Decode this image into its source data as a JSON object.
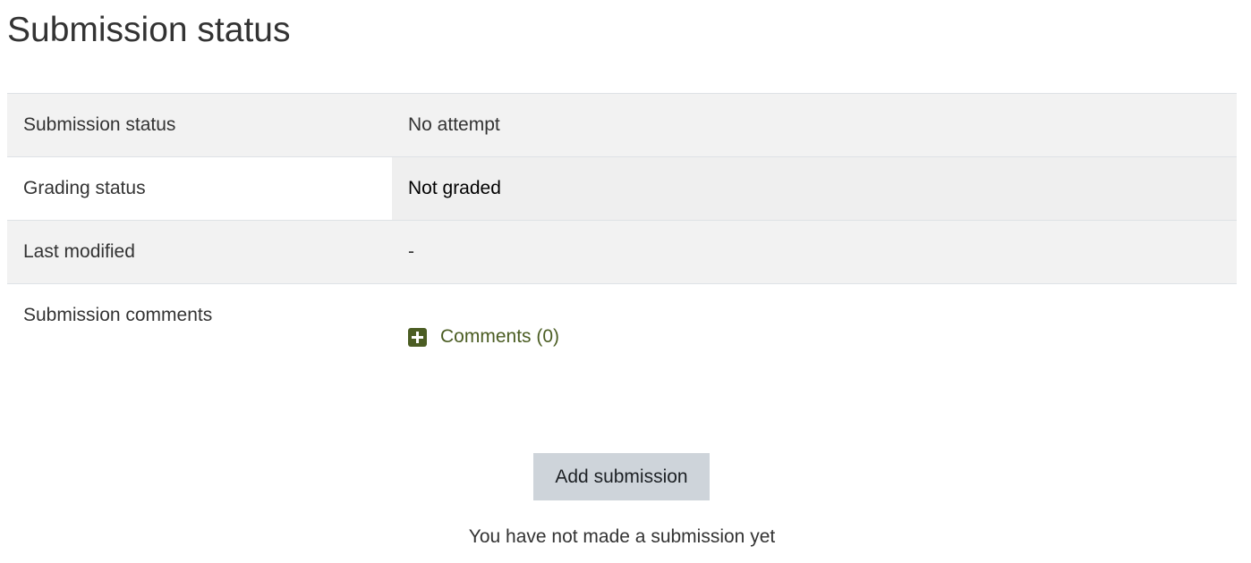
{
  "page_title": "Submission status",
  "table": {
    "rows": [
      {
        "label": "Submission status",
        "value": "No attempt"
      },
      {
        "label": "Grading status",
        "value": "Not graded"
      },
      {
        "label": "Last modified",
        "value": "-"
      },
      {
        "label": "Submission comments",
        "value": "Comments (0)"
      }
    ]
  },
  "colors": {
    "comments_link": "#4b5d23",
    "button_bg": "#ced4da",
    "row_shade": "#f2f2f2"
  },
  "icons": {
    "comments_toggle": "plus-square-icon"
  },
  "actions": {
    "add_submission_label": "Add submission"
  },
  "note": "You have not made a submission yet"
}
